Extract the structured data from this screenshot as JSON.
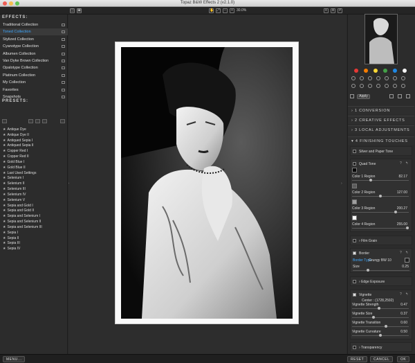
{
  "window": {
    "title": "Topaz B&W Effects 2 (v2.1.0)"
  },
  "toolbar": {
    "zoom": "30.0%"
  },
  "effects": {
    "heading": "EFFECTS:",
    "collections": [
      "Traditional Collection",
      "Toned Collection",
      "Stylized Collection",
      "Cyanotype Collection",
      "Albumen Collection",
      "Van Dyke Brown Collection",
      "Opalotype Collection",
      "Platinum Collection",
      "My Collection",
      "Favorites",
      "Snapshots"
    ],
    "selected_index": 1
  },
  "presets": {
    "heading": "PRESETS:",
    "items": [
      "Antique Dye",
      "Antique Dye II",
      "Antiqued Sepia I",
      "Antiqued Sepia II",
      "Copper Red I",
      "Copper Red II",
      "Gold Blue I",
      "Gold Blue II",
      "Last Used Settings",
      "Selenium I",
      "Selenium II",
      "Selenium III",
      "Selenium IV",
      "Selenium V",
      "Sepia and Gold I",
      "Sepia and Gold II",
      "Sepia and Selenium I",
      "Sepia and Selenium II",
      "Sepia and Selenium III",
      "Sepia I",
      "Sepia II",
      "Sepia III",
      "Sepia IV"
    ]
  },
  "right": {
    "apply": "Apply",
    "sections": [
      "1 CONVERSION",
      "2 CREATIVE EFFECTS",
      "3 LOCAL ADJUSTMENTS",
      "4 FINISHING TOUCHES"
    ],
    "silver": "Silver and Paper Tone",
    "quad": {
      "title": "Quad Tone",
      "regions": [
        {
          "label": "Color 1 Region",
          "value": "82.17",
          "color": "#080808"
        },
        {
          "label": "Color 2 Region",
          "value": "127.00",
          "color": "#5c5c5c"
        },
        {
          "label": "Color 3 Region",
          "value": "200.27",
          "color": "#9e9e9e"
        },
        {
          "label": "Color 4 Region",
          "value": "255.00",
          "color": "#ffffff"
        }
      ]
    },
    "film": "Film Grain",
    "border": {
      "title": "Border",
      "type_label": "Border Type",
      "type_value": "Grungy BW 10",
      "size_label": "Size",
      "size_value": "0.25"
    },
    "edge": "Edge Exposure",
    "vignette": {
      "title": "Vignette",
      "center": "Center : (1728,2592)",
      "rows": [
        {
          "label": "Vignette Strength",
          "value": "0.47"
        },
        {
          "label": "Vignette Size",
          "value": "0.37"
        },
        {
          "label": "Vignette Transition",
          "value": "0.60"
        },
        {
          "label": "Vignette Curvature",
          "value": "0.50"
        }
      ]
    },
    "transparency": "Transparency"
  },
  "bottom": {
    "menu": "MENU...",
    "reset": "RESET",
    "cancel": "CANCEL",
    "ok": "OK"
  },
  "colors": {
    "accent": "#3ea8ff",
    "panel": "#2c2c2c",
    "canvas": "#2d2d2d"
  },
  "swatch_dots": [
    "#e53935",
    "#f57c00",
    "#fdd835",
    "#43a047",
    "#1e88e5",
    "#f5f5f5"
  ]
}
